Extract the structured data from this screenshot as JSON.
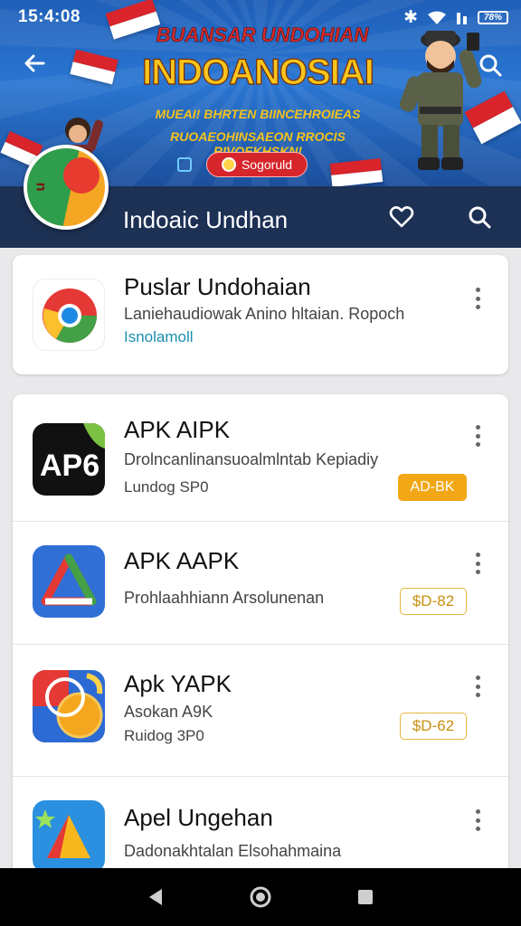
{
  "status_bar": {
    "time": "15:4:08",
    "battery": "78%"
  },
  "banner": {
    "title_small": "BUANSAR UNDOHIAN",
    "title_big": "INDOANOSIAI",
    "line1": "MUEAI! BHRTEN BIINCEHROIEAS",
    "line2": "RUOAEOHINSAEON RROCIS RIVOEKHSKN!",
    "button_label": "Sogoruld"
  },
  "app_bar": {
    "title": "Indoaic Undhan"
  },
  "featured": {
    "title": "Puslar Undohaian",
    "subtitle": "Laniehaudiowak Anino hltaian. Ropoch",
    "link": "Isnolamoll"
  },
  "apps": [
    {
      "title": "APK AIPK",
      "line1": "Drolncanlinansuoalmlntab Kepiadiy",
      "line2": "Lundog SP0",
      "badge": "AD-BK",
      "badge_style": "filled",
      "icon": "apk-text-icon"
    },
    {
      "title": "APK AAPK",
      "line1": "Prohlaahhiann Arsolunenan",
      "line2": "",
      "badge": "$D-82",
      "badge_style": "outline",
      "icon": "triangle-icon"
    },
    {
      "title": "Apk YAPK",
      "line1": "Asokan A9K",
      "line2": "Ruidog 3P0",
      "badge": "$D-62",
      "badge_style": "outline",
      "icon": "coins-icon"
    },
    {
      "title": "Apel Ungehan",
      "line1": "Dadonakhtalan Elsohahmaina",
      "line2": "",
      "badge": "",
      "badge_style": "none",
      "icon": "star-triangle-icon"
    }
  ],
  "colors": {
    "app_bar": "#1d3155",
    "badge_fill": "#f1a716",
    "badge_outline": "#e5b63d",
    "link": "#1a8fb0"
  }
}
